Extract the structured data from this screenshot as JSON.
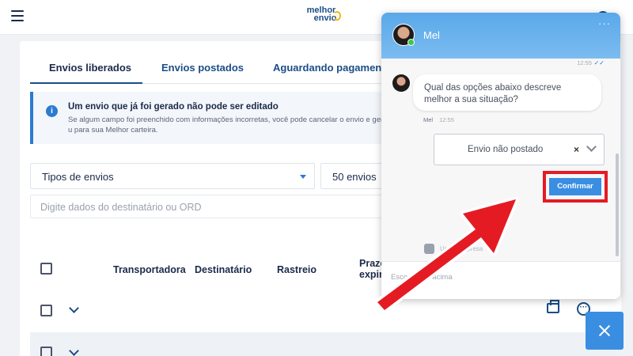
{
  "logo": {
    "line1": "melhor",
    "line2": "envio"
  },
  "tabs": [
    {
      "label": "Envios liberados",
      "active": true
    },
    {
      "label": "Envios postados",
      "active": false
    },
    {
      "label": "Aguardando pagamento",
      "active": false
    }
  ],
  "alert": {
    "title": "Um envio que já foi gerado não pode ser editado",
    "body": "Se algum campo foi preenchido com informações incorretas, você pode cancelar o envio e gerar u para sua Melhor carteira."
  },
  "filters": {
    "tipos": "Tipos de envios",
    "qtd": "50 envios",
    "search_placeholder": "Digite dados do destinatário ou ORD"
  },
  "table": {
    "columns": [
      "Transportadora",
      "Destinatário",
      "Rastreio"
    ],
    "prazo": "Prazo",
    "prazo2": "expir"
  },
  "chat": {
    "agent_name": "Mel",
    "top_time": "12:55",
    "message": "Qual das opções abaixo descreve melhor a sua situação?",
    "message_sender": "Mel",
    "message_time": "12:55",
    "selected_option": "Envio não postado",
    "clear_symbol": "×",
    "confirm_label": "Confirmar",
    "footer_text": "Us                 da empresa",
    "input_placeholder": "Esco         opção acima"
  },
  "colors": {
    "accent": "#3a8ee2",
    "highlight": "#e51b23",
    "header": "#5aa8ea"
  }
}
